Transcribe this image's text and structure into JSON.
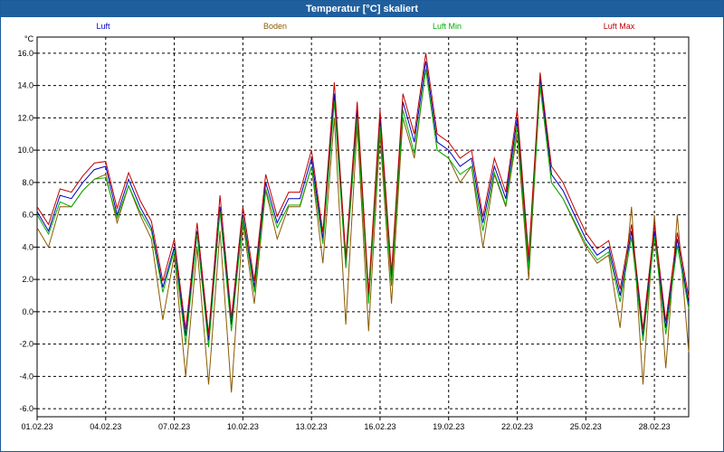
{
  "window": {
    "title": "Temperatur [°C] skaliert"
  },
  "chart_data": {
    "type": "line",
    "title": "Temperatur [°C] skaliert",
    "ylabel": "°C",
    "xlabel": "",
    "ylim": [
      -6.5,
      17.0
    ],
    "xlim": [
      0,
      28.5
    ],
    "yticks": [
      -6,
      -4,
      -2,
      0,
      2,
      4,
      6,
      8,
      10,
      12,
      14,
      16
    ],
    "ytick_labels": [
      "-6.0",
      "-4.0",
      "-2.0",
      "0.0",
      "2.0",
      "4.0",
      "6.0",
      "8.0",
      "10.0",
      "12.0",
      "14.0",
      "16.0"
    ],
    "xticks": [
      0,
      3,
      6,
      9,
      12,
      15,
      18,
      21,
      24,
      27
    ],
    "xtick_labels": [
      "01.02.23",
      "04.02.23",
      "07.02.23",
      "10.02.23",
      "13.02.23",
      "16.02.23",
      "19.02.23",
      "22.02.23",
      "25.02.23",
      "28.02.23"
    ],
    "grid": true,
    "legend_position": "top",
    "x": [
      0,
      0.5,
      1,
      1.5,
      2,
      2.5,
      3,
      3.5,
      4,
      4.5,
      5,
      5.5,
      6,
      6.5,
      7,
      7.5,
      8,
      8.5,
      9,
      9.5,
      10,
      10.5,
      11,
      11.5,
      12,
      12.5,
      13,
      13.5,
      14,
      14.5,
      15,
      15.5,
      16,
      16.5,
      17,
      17.5,
      18,
      18.5,
      19,
      19.5,
      20,
      20.5,
      21,
      21.5,
      22,
      22.5,
      23,
      23.5,
      24,
      24.5,
      25,
      25.5,
      26,
      26.5,
      27,
      27.5,
      28,
      28.5
    ],
    "series": [
      {
        "name": "Luft",
        "color": "#0000c0",
        "values": [
          6.2,
          5.0,
          7.2,
          7.0,
          8.0,
          8.8,
          9.0,
          6.0,
          8.2,
          6.5,
          5.2,
          1.5,
          4.0,
          -1.5,
          5.0,
          -1.8,
          6.5,
          -0.8,
          6.0,
          1.5,
          8.0,
          5.5,
          7.0,
          7.0,
          9.5,
          4.5,
          13.5,
          3.0,
          12.5,
          0.8,
          12.0,
          2.0,
          13.0,
          10.5,
          15.5,
          10.5,
          10.0,
          9.0,
          9.5,
          5.5,
          9.0,
          7.0,
          12.0,
          3.0,
          14.5,
          8.5,
          7.5,
          6.0,
          4.5,
          3.5,
          4.0,
          1.0,
          5.0,
          -1.5,
          5.0,
          -1.0,
          4.5,
          0.5
        ]
      },
      {
        "name": "Boden",
        "color": "#8b5a00",
        "values": [
          5.2,
          4.0,
          6.5,
          6.5,
          7.5,
          8.2,
          8.5,
          5.5,
          7.8,
          6.0,
          4.5,
          -0.5,
          3.5,
          -4.0,
          4.0,
          -4.5,
          5.0,
          -5.0,
          5.5,
          0.5,
          7.5,
          4.5,
          6.5,
          6.5,
          9.0,
          3.0,
          12.0,
          -0.8,
          11.5,
          -1.2,
          11.0,
          0.5,
          12.0,
          9.5,
          15.0,
          10.0,
          9.5,
          8.0,
          9.0,
          4.0,
          8.5,
          6.5,
          11.0,
          2.0,
          14.0,
          8.0,
          7.0,
          5.5,
          4.0,
          3.0,
          3.5,
          -1.0,
          6.5,
          -4.5,
          6.0,
          -3.5,
          6.0,
          -2.5
        ]
      },
      {
        "name": "Luft Min",
        "color": "#00b000",
        "values": [
          6.0,
          4.8,
          6.8,
          6.5,
          7.5,
          8.2,
          8.3,
          5.8,
          7.8,
          6.2,
          5.0,
          1.2,
          3.8,
          -2.0,
          4.8,
          -2.2,
          6.2,
          -1.2,
          5.8,
          1.2,
          7.6,
          5.2,
          6.6,
          6.6,
          9.0,
          4.2,
          13.0,
          2.7,
          12.0,
          0.5,
          11.5,
          1.6,
          12.5,
          9.8,
          15.0,
          10.0,
          9.5,
          8.5,
          9.0,
          5.0,
          8.6,
          6.6,
          11.5,
          2.6,
          14.0,
          8.0,
          7.0,
          5.6,
          4.2,
          3.2,
          3.7,
          0.6,
          4.6,
          -1.8,
          4.6,
          -1.4,
          4.1,
          0.2
        ]
      },
      {
        "name": "Luft Max",
        "color": "#c00000",
        "values": [
          6.5,
          5.4,
          7.6,
          7.4,
          8.4,
          9.2,
          9.3,
          6.4,
          8.6,
          6.9,
          5.6,
          1.9,
          4.5,
          -1.1,
          5.5,
          -1.4,
          7.2,
          -0.4,
          6.5,
          1.9,
          8.5,
          5.9,
          7.4,
          7.4,
          10.0,
          4.9,
          14.2,
          3.4,
          13.0,
          1.2,
          12.5,
          2.4,
          13.5,
          11.0,
          16.0,
          11.0,
          10.5,
          9.5,
          10.0,
          5.9,
          9.5,
          7.4,
          12.5,
          3.4,
          14.8,
          9.0,
          8.0,
          6.4,
          4.9,
          3.9,
          4.4,
          1.4,
          5.4,
          -1.1,
          5.4,
          -0.6,
          4.9,
          0.9
        ]
      }
    ]
  }
}
